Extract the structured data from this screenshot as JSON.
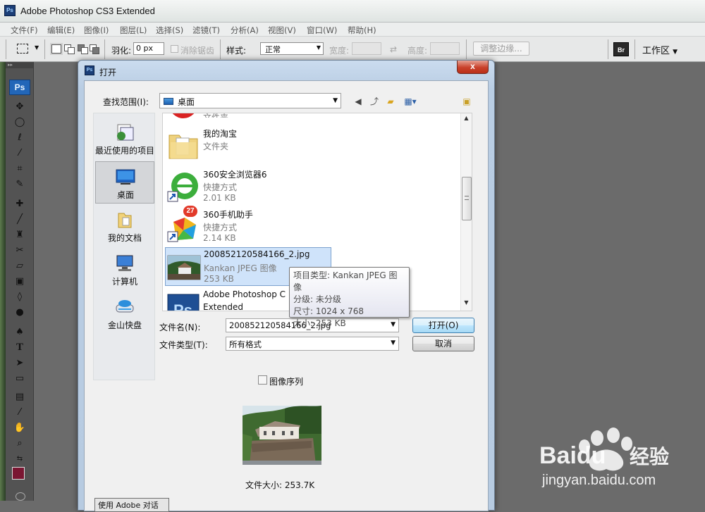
{
  "app": {
    "title": "Adobe Photoshop CS3 Extended",
    "logo": "Ps"
  },
  "menu": [
    "文件(F)",
    "编辑(E)",
    "图像(I)",
    "图层(L)",
    "选择(S)",
    "滤镜(T)",
    "分析(A)",
    "视图(V)",
    "窗口(W)",
    "帮助(H)"
  ],
  "options": {
    "feather_label": "羽化:",
    "feather_value": "0 px",
    "antialias_label": "消除锯齿",
    "style_label": "样式:",
    "style_value": "正常",
    "width_label": "宽度:",
    "height_label": "高度:",
    "refine_edge": "调整边缘...",
    "workspace": "工作区"
  },
  "toolbox": {
    "badge": "Ps",
    "fg_color": "#7a1632",
    "bg_color": "#000000"
  },
  "dialog": {
    "title": "打开",
    "close": "x",
    "lookin_label": "查找范围(I):",
    "lookin_value": "桌面",
    "places": [
      {
        "label": "最近使用的项目",
        "icon": "recent-items-icon"
      },
      {
        "label": "桌面",
        "icon": "desktop-icon"
      },
      {
        "label": "我的文档",
        "icon": "documents-icon"
      },
      {
        "label": "计算机",
        "icon": "computer-icon"
      },
      {
        "label": "金山快盘",
        "icon": "kuaipan-drive-icon"
      }
    ],
    "files": [
      {
        "name": "",
        "type": "文件夹",
        "size": "",
        "icon": "red-circle-icon"
      },
      {
        "name": "我的淘宝",
        "type": "文件夹",
        "size": "",
        "icon": "folder-icon"
      },
      {
        "name": "360安全浏览器6",
        "type": "快捷方式",
        "size": "2.01 KB",
        "icon": "browser-360-icon"
      },
      {
        "name": "360手机助手",
        "type": "快捷方式",
        "size": "2.14 KB",
        "icon": "phone-assistant-360-icon"
      },
      {
        "name": "200852120584166_2.jpg",
        "type": "Kankan JPEG 图像",
        "size": "253 KB",
        "icon": "jpeg-thumbnail-icon"
      },
      {
        "name": "Adobe Photoshop C",
        "type": "Extended",
        "size": "",
        "icon": "photoshop-icon"
      }
    ],
    "badge_27": "27",
    "tooltip": [
      "项目类型: Kankan JPEG 图像",
      "分级: 未分级",
      "尺寸: 1024 x 768",
      "大小: 253 KB"
    ],
    "filename_label": "文件名(N):",
    "filename_value": "200852120584166_2.jpg",
    "filetype_label": "文件类型(T):",
    "filetype_value": "所有格式",
    "open_button": "打开(O)",
    "cancel_button": "取消",
    "sequence_label": "图像序列",
    "filesize_label": "文件大小: 253.7K",
    "bottom_button": "使用 Adobe 对话框"
  },
  "watermark": {
    "brand": "Baidu",
    "suffix": "经验",
    "url": "jingyan.baidu.com"
  }
}
